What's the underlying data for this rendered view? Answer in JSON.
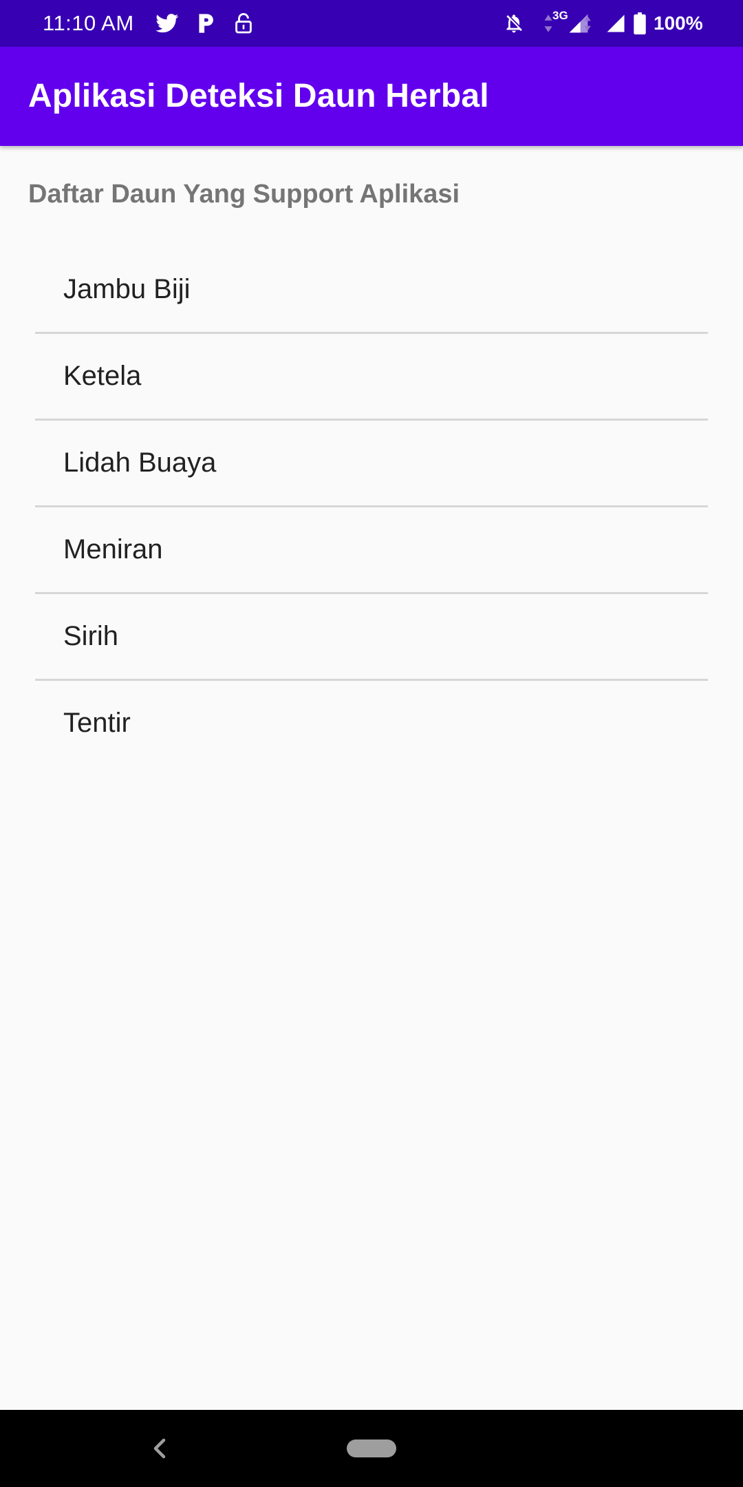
{
  "status_bar": {
    "time": "11:10 AM",
    "network_type": "3G",
    "battery_percent": "100%",
    "icons": [
      "twitter-icon",
      "p-icon",
      "lock-open-icon",
      "bell-off-icon",
      "data-arrows-icon",
      "signal-icon",
      "battery-icon"
    ],
    "background_color": "#3700b3"
  },
  "app_bar": {
    "title": "Aplikasi Deteksi Daun Herbal",
    "background_color": "#6200ee"
  },
  "content": {
    "heading": "Daftar Daun Yang Support Aplikasi",
    "items": [
      {
        "label": "Jambu Biji"
      },
      {
        "label": "Ketela"
      },
      {
        "label": "Lidah Buaya"
      },
      {
        "label": "Meniran"
      },
      {
        "label": "Sirih"
      },
      {
        "label": "Tentir"
      }
    ]
  },
  "nav_bar": {
    "icons": [
      "back-icon",
      "home-pill-icon"
    ]
  }
}
